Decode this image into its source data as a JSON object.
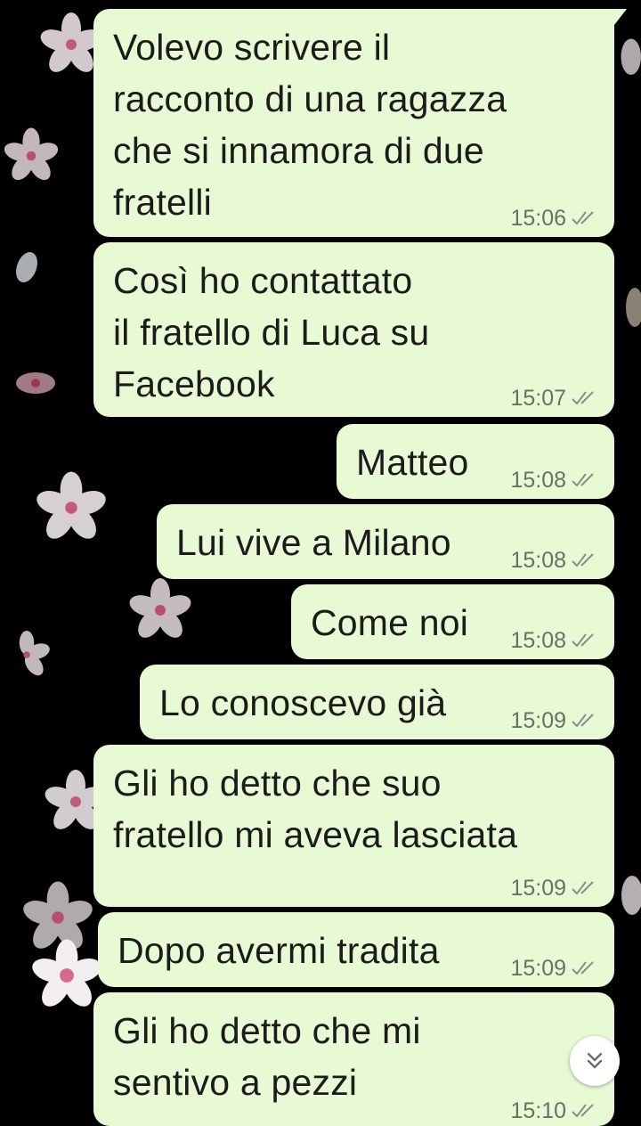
{
  "theme": {
    "bubble_color": "#e8fad3",
    "background_color": "#000000",
    "meta_color": "#6c6f66"
  },
  "messages": [
    {
      "text": "Volevo scrivere il\nracconto di una ragazza\nche si innamora di due\nfratelli",
      "time": "15:06",
      "status": "read"
    },
    {
      "text": "Così ho contattato\nil fratello di Luca su\nFacebook",
      "time": "15:07",
      "status": "read"
    },
    {
      "text": "Matteo",
      "time": "15:08",
      "status": "read"
    },
    {
      "text": "Lui vive a Milano",
      "time": "15:08",
      "status": "read"
    },
    {
      "text": "Come noi",
      "time": "15:08",
      "status": "read"
    },
    {
      "text": "Lo conoscevo già",
      "time": "15:09",
      "status": "read"
    },
    {
      "text": "Gli ho detto che suo\nfratello mi aveva lasciata",
      "time": "15:09",
      "status": "read"
    },
    {
      "text": "Dopo avermi tradita",
      "time": "15:09",
      "status": "read"
    },
    {
      "text": "Gli ho detto che mi\nsentivo a pezzi",
      "time": "15:10",
      "status": "read"
    }
  ],
  "scroll_button": {
    "icon": "double-chevron-down-icon"
  },
  "wallpaper": {
    "icon": "cherry-blossom-icon"
  }
}
